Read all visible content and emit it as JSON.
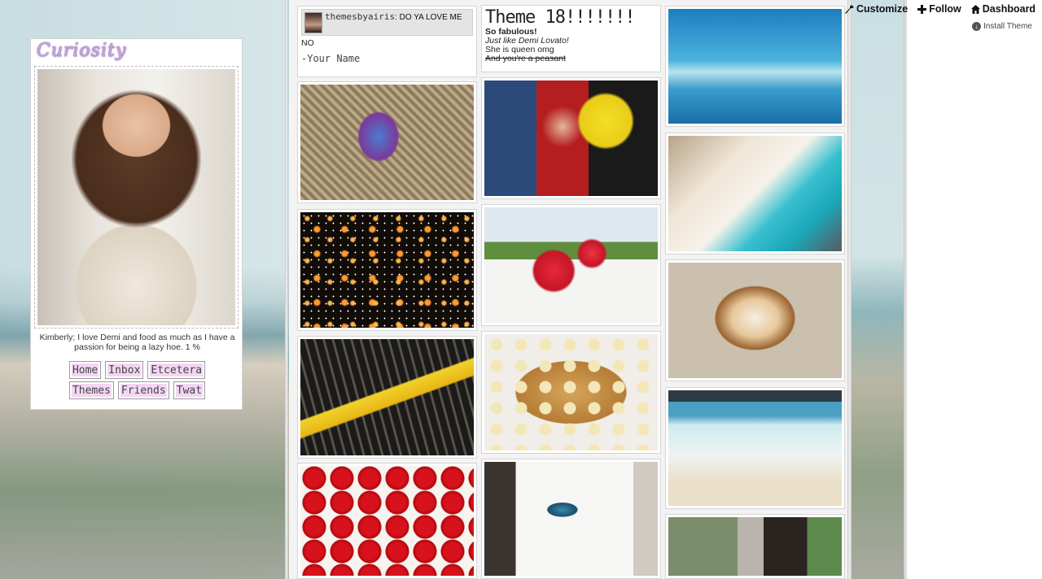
{
  "sidebar": {
    "title": "Curiosity",
    "bio": "Kimberly; I love Demi and food as much as I have a passion for being a lazy hoe. 1 %",
    "nav_row1": [
      "Home",
      "Inbox",
      "Etcetera"
    ],
    "nav_row2": [
      "Themes",
      "Friends",
      "Twat"
    ]
  },
  "ask_post": {
    "asker": "themesbyairis",
    "question": "DO YA LOVE ME",
    "answer": "NO",
    "signature": "-Your Name"
  },
  "text_post": {
    "title": "Theme 18!!!!!!!",
    "lines": [
      "So fabulous!",
      "Just like Demi Lovato!",
      "She is queen omg",
      "And you're a peasant"
    ]
  },
  "controls": {
    "customize": "Customize",
    "follow": "Follow",
    "dashboard": "Dashboard",
    "install": "Install Theme"
  },
  "colors": {
    "nav_button_bg": "#f3d6f3",
    "title_color": "#c9a6e8"
  }
}
